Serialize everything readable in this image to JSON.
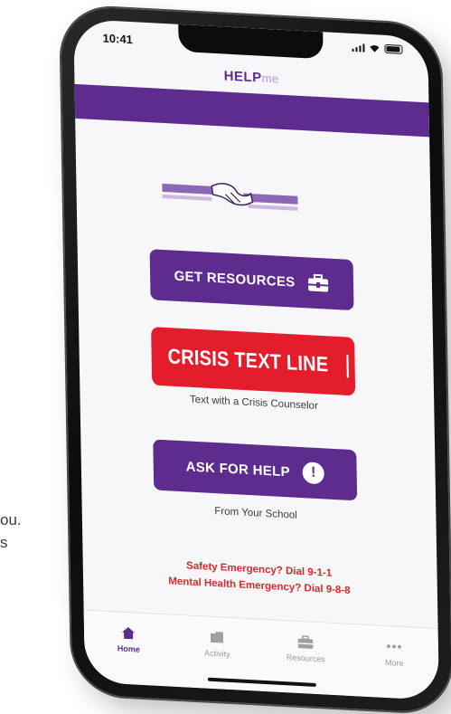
{
  "background_text": {
    "line1": "ou.",
    "line2": "s"
  },
  "status_bar": {
    "time": "10:41"
  },
  "header": {
    "logo_main": "HELP",
    "logo_sub": "me"
  },
  "buttons": {
    "get_resources": "GET RESOURCES",
    "crisis_text_line": "CRISIS TEXT LINE",
    "ask_for_help": "ASK FOR HELP",
    "ask_for_help_icon": "!"
  },
  "captions": {
    "crisis": "Text with a Crisis Counselor",
    "school": "From Your School"
  },
  "emergency": {
    "safety": "Safety Emergency? Dial 9-1-1",
    "mental_health": "Mental Health Emergency? Dial 9-8-8"
  },
  "tabs": [
    {
      "label": "Home",
      "icon": "home-icon",
      "active": true
    },
    {
      "label": "Activity",
      "icon": "folder-icon",
      "active": false
    },
    {
      "label": "Resources",
      "icon": "toolbox-icon",
      "active": false
    },
    {
      "label": "More",
      "icon": "more-dots-icon",
      "active": false
    }
  ],
  "colors": {
    "brand_purple": "#5e2c8f",
    "crisis_red": "#e31d2b",
    "emergency_red": "#d52b2b"
  }
}
